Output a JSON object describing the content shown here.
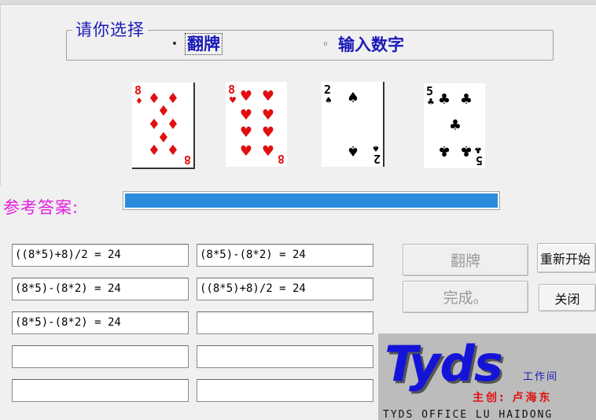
{
  "selection": {
    "title": "请你选择",
    "option_flip": "翻牌",
    "option_input": "输入数字",
    "selected": "翻牌"
  },
  "cards": [
    {
      "rank": "8",
      "suit": "diamond-icon",
      "symbol": "♦",
      "color": "#e01010"
    },
    {
      "rank": "8",
      "suit": "heart-icon",
      "symbol": "♥",
      "color": "#e01010"
    },
    {
      "rank": "2",
      "suit": "spade-icon",
      "symbol": "♠",
      "color": "#000000"
    },
    {
      "rank": "5",
      "suit": "club-icon",
      "symbol": "♣",
      "color": "#000000"
    }
  ],
  "reference": {
    "label": "参考答案:",
    "progress": 1.0
  },
  "answers": [
    [
      "((8*5)+8)/2 = 24",
      "(8*5)-(8*2) = 24"
    ],
    [
      "(8*5)-(8*2) = 24",
      "((8*5)+8)/2 = 24"
    ],
    [
      "(8*5)-(8*2) = 24",
      ""
    ],
    [
      "",
      ""
    ],
    [
      "",
      ""
    ]
  ],
  "buttons": {
    "flip": "翻牌",
    "done": "完成。",
    "restart": "重新开始",
    "close": "关闭"
  },
  "logo": {
    "name": "Tyds",
    "studio": "工作间",
    "author": "主创: 卢海东",
    "english": "TYDS OFFICE  LU HAIDONG"
  }
}
